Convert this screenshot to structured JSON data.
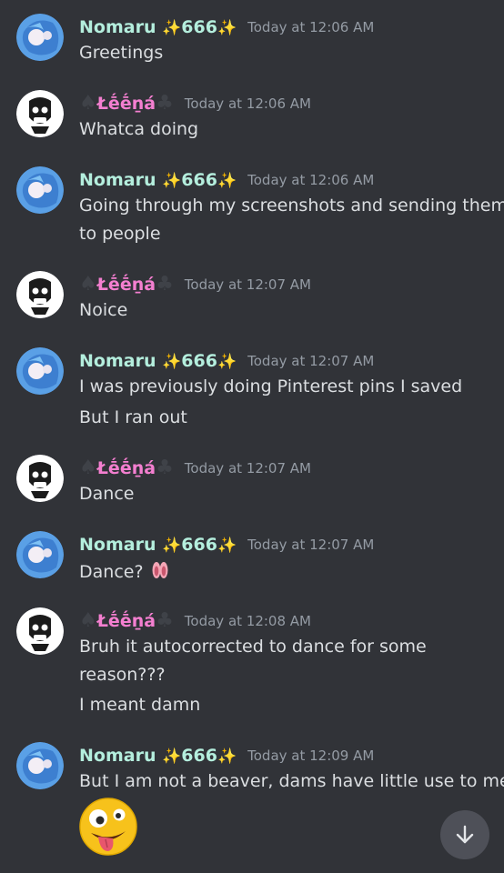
{
  "messages": [
    {
      "author": "Nomaru",
      "decor_mid": "666",
      "timestamp": "Today at 12:06 AM",
      "lines": [
        "Greetings"
      ]
    },
    {
      "author": "Łḗḗṉá",
      "timestamp": "Today at 12:06 AM",
      "lines": [
        "Whatca doing"
      ]
    },
    {
      "author": "Nomaru",
      "decor_mid": "666",
      "timestamp": "Today at 12:06 AM",
      "lines": [
        "Going through my screenshots and sending them",
        "to people"
      ]
    },
    {
      "author": "Łḗḗṉá",
      "timestamp": "Today at 12:07 AM",
      "lines": [
        "Noice"
      ]
    },
    {
      "author": "Nomaru",
      "decor_mid": "666",
      "timestamp": "Today at 12:07 AM",
      "lines": [
        "I was previously doing Pinterest pins I saved",
        "But I ran out"
      ]
    },
    {
      "author": "Łḗḗṉá",
      "timestamp": "Today at 12:07 AM",
      "lines": [
        "Dance"
      ]
    },
    {
      "author": "Nomaru",
      "decor_mid": "666",
      "timestamp": "Today at 12:07 AM",
      "lines": [
        "Dance?"
      ],
      "emoji": "ballet-shoes-emoji"
    },
    {
      "author": "Łḗḗṉá",
      "timestamp": "Today at 12:08 AM",
      "lines": [
        "Bruh it autocorrected to dance for some",
        "reason???",
        "I meant damn"
      ]
    },
    {
      "author": "Nomaru",
      "decor_mid": "666",
      "timestamp": "Today at 12:09 AM",
      "lines": [
        "But I am not a beaver, dams have little use to me"
      ],
      "emoji": "zany-face-emoji"
    }
  ],
  "icons": {
    "sparkles": "✨",
    "spade": "♠",
    "club": "♣",
    "scroll_down": "arrow-down-icon"
  },
  "colors": {
    "background": "#313338",
    "nomaru_name": "#b4eedd",
    "leena_name": "#f47fd0",
    "timestamp": "#949ba4",
    "text": "#dbdee1"
  }
}
